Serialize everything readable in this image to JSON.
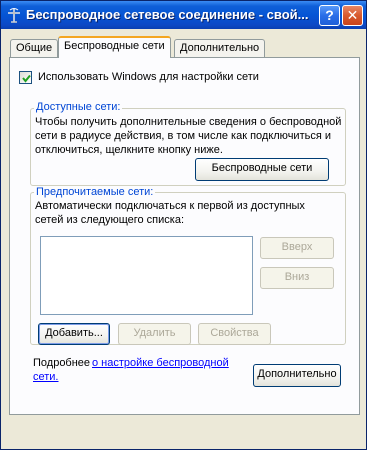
{
  "window": {
    "title": "Беспроводное сетевое соединение - свой...",
    "help_label": "?",
    "close_label": "✕"
  },
  "tabs": [
    {
      "label": "Общие",
      "active": false
    },
    {
      "label": "Беспроводные сети",
      "active": true
    },
    {
      "label": "Дополнительно",
      "active": false
    }
  ],
  "use_windows": {
    "label": "Использовать Windows для настройки сети",
    "checked": true
  },
  "available": {
    "title": "Доступные сети:",
    "desc_line1": "Чтобы получить дополнительные сведения о беспроводной",
    "desc_line2": "сети в радиусе действия, в том числе как подключиться и",
    "desc_line3": "отключиться, щелкните кнопку ниже.",
    "button": "Беспроводные сети"
  },
  "preferred": {
    "title": "Предпочитаемые сети:",
    "desc_line1": "Автоматически подключаться к первой из доступных",
    "desc_line2": "сетей из следующего списка:",
    "items": [],
    "up_button": "Вверх",
    "down_button": "Вниз",
    "add_button": "Добавить...",
    "remove_button": "Удалить",
    "properties_button": "Свойства"
  },
  "footer": {
    "more_prefix": "Подробнее",
    "more_link_1": "о настройке  беспроводной",
    "more_link_2": "сети.",
    "advanced_button": "Дополнительно"
  },
  "colors": {
    "titlebar": "#0555d5",
    "group_title": "#0046d5",
    "link": "#0000ff",
    "active_tab_accent": "#f4a621"
  }
}
